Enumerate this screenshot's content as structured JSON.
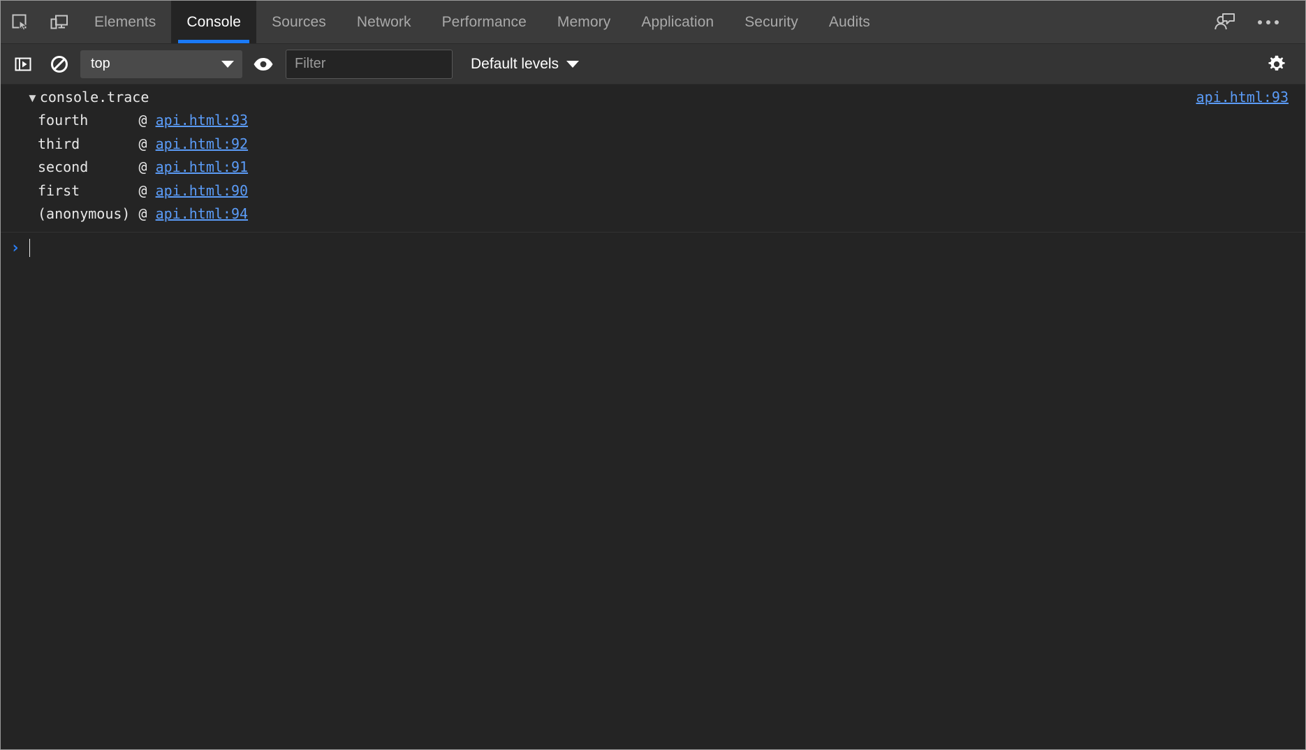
{
  "tabbar": {
    "inspect_icon": "inspect-element-icon",
    "device_icon": "device-toolbar-icon",
    "tabs": [
      {
        "label": "Elements",
        "active": false
      },
      {
        "label": "Console",
        "active": true
      },
      {
        "label": "Sources",
        "active": false
      },
      {
        "label": "Network",
        "active": false
      },
      {
        "label": "Performance",
        "active": false
      },
      {
        "label": "Memory",
        "active": false
      },
      {
        "label": "Application",
        "active": false
      },
      {
        "label": "Security",
        "active": false
      },
      {
        "label": "Audits",
        "active": false
      }
    ],
    "feedback_icon": "feedback-person-icon",
    "more_icon": "more-options-icon",
    "active_tab_color": "#1a7af8"
  },
  "filterbar": {
    "sidebar_toggle_icon": "console-sidebar-toggle-icon",
    "clear_icon": "clear-console-icon",
    "context": {
      "value": "top",
      "caret_icon": "chevron-down-icon"
    },
    "eye_icon": "live-expressions-eye-icon",
    "filter": {
      "value": "",
      "placeholder": "Filter"
    },
    "levels": {
      "label": "Default levels",
      "caret_icon": "chevron-down-icon"
    },
    "settings_icon": "settings-gear-icon"
  },
  "console": {
    "messages": [
      {
        "disclosure": "▼",
        "title": "console.trace",
        "source_link": "api.html:93",
        "stack": [
          {
            "fn": "fourth",
            "at": "@",
            "link": "api.html:93"
          },
          {
            "fn": "third",
            "at": "@",
            "link": "api.html:92"
          },
          {
            "fn": "second",
            "at": "@",
            "link": "api.html:91"
          },
          {
            "fn": "first",
            "at": "@",
            "link": "api.html:90"
          },
          {
            "fn": "(anonymous)",
            "at": "@",
            "link": "api.html:94"
          }
        ]
      }
    ],
    "prompt": {
      "chevron": "›",
      "value": ""
    },
    "link_color": "#5b9cf8"
  }
}
